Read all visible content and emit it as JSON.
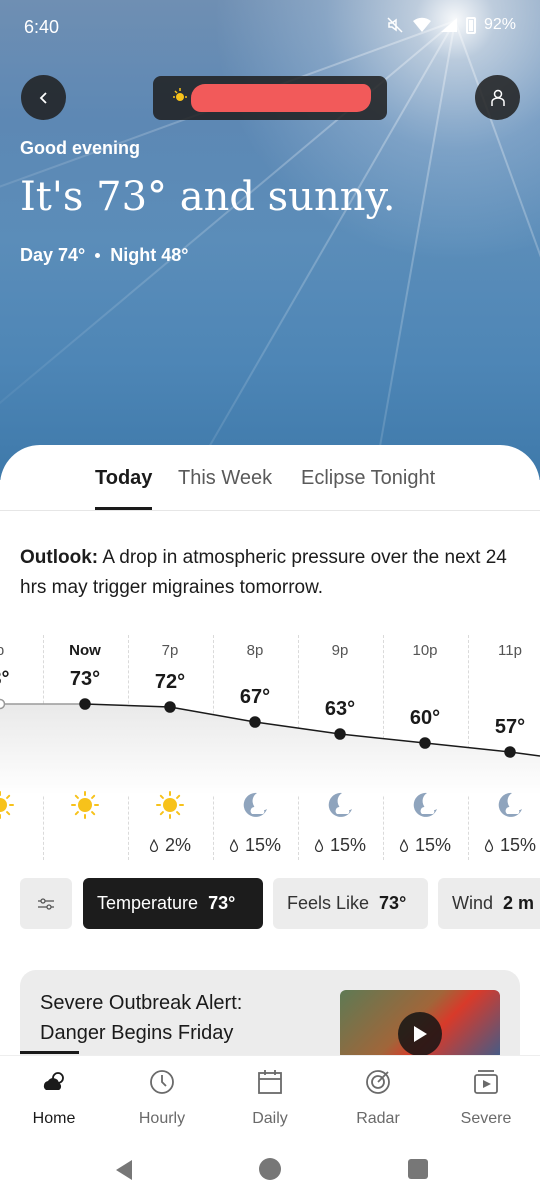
{
  "status_bar": {
    "time": "6:40",
    "battery": "92%"
  },
  "header": {
    "greeting": "Good evening",
    "headline": "It's 73° and sunny.",
    "day": "Day 74°",
    "night": "Night 48°"
  },
  "tabs": [
    {
      "label": "Today",
      "active": true
    },
    {
      "label": "This Week",
      "active": false
    },
    {
      "label": "Eclipse Tonight",
      "active": false
    }
  ],
  "outlook": {
    "label": "Outlook:",
    "text": "A drop in atmospheric pressure over the next 24 hrs may trigger migraines tomorrow."
  },
  "hourly": [
    {
      "time": "p",
      "temp": "3°",
      "icon": "sun-icon",
      "precip": ""
    },
    {
      "time": "Now",
      "temp": "73°",
      "icon": "sun-icon",
      "precip": ""
    },
    {
      "time": "7p",
      "temp": "72°",
      "icon": "sun-icon",
      "precip": "2%"
    },
    {
      "time": "8p",
      "temp": "67°",
      "icon": "moon-cloud-icon",
      "precip": "15%"
    },
    {
      "time": "9p",
      "temp": "63°",
      "icon": "moon-cloud-icon",
      "precip": "15%"
    },
    {
      "time": "10p",
      "temp": "60°",
      "icon": "moon-cloud-icon",
      "precip": "15%"
    },
    {
      "time": "11p",
      "temp": "57°",
      "icon": "moon-cloud-icon",
      "precip": "15%"
    }
  ],
  "chips": [
    {
      "label": "Temperature",
      "value": "73°",
      "active": true
    },
    {
      "label": "Feels Like",
      "value": "73°",
      "active": false
    },
    {
      "label": "Wind",
      "value": "2 m",
      "active": false
    }
  ],
  "alert_card": {
    "title_line1": "Severe Outbreak Alert:",
    "title_line2": "Danger Begins Friday"
  },
  "bottom_nav": [
    {
      "label": "Home",
      "icon": "cloud-sun-icon",
      "active": true
    },
    {
      "label": "Hourly",
      "icon": "clock-icon",
      "active": false
    },
    {
      "label": "Daily",
      "icon": "calendar-icon",
      "active": false
    },
    {
      "label": "Radar",
      "icon": "radar-icon",
      "active": false
    },
    {
      "label": "Severe",
      "icon": "severe-icon",
      "active": false
    }
  ],
  "colors": {
    "accent_dark": "#1c1c1c",
    "sun": "#f7c21b",
    "moon": "#8fa4bd",
    "redaction": "#f25a5a"
  }
}
